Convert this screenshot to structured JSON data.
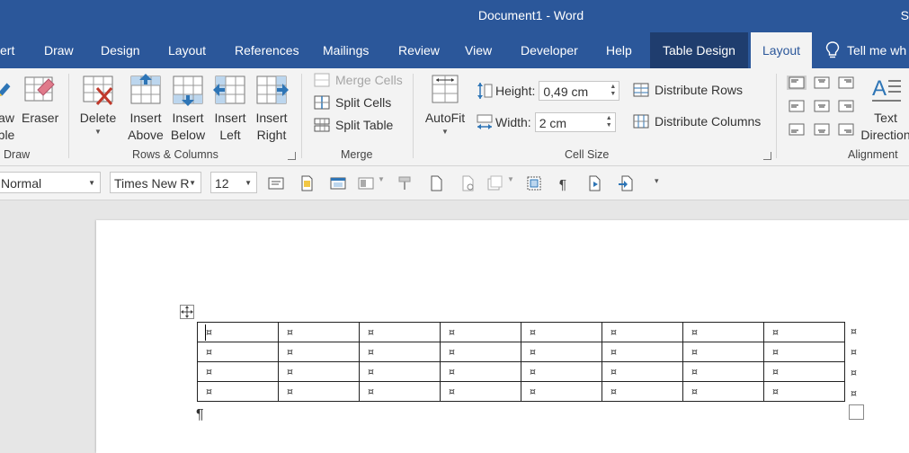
{
  "window": {
    "title": "Document1  -  Word",
    "corner_letter": "S"
  },
  "tabs": [
    {
      "label": "ert"
    },
    {
      "label": "Draw"
    },
    {
      "label": "Design"
    },
    {
      "label": "Layout"
    },
    {
      "label": "References"
    },
    {
      "label": "Mailings"
    },
    {
      "label": "Review"
    },
    {
      "label": "View"
    },
    {
      "label": "Developer"
    },
    {
      "label": "Help"
    },
    {
      "label": "Table Design"
    },
    {
      "label": "Layout",
      "active": true
    }
  ],
  "tell_me": {
    "label": "Tell me wh"
  },
  "ribbon": {
    "draw": {
      "draw_table_label_1": "aw",
      "draw_table_label_2": "ble",
      "eraser_label": "Eraser",
      "group_label": "Draw"
    },
    "rows_columns": {
      "delete_label": "Delete",
      "insert_above_1": "Insert",
      "insert_above_2": "Above",
      "insert_below_1": "Insert",
      "insert_below_2": "Below",
      "insert_left_1": "Insert",
      "insert_left_2": "Left",
      "insert_right_1": "Insert",
      "insert_right_2": "Right",
      "group_label": "Rows & Columns"
    },
    "merge": {
      "merge_cells": "Merge Cells",
      "split_cells": "Split Cells",
      "split_table": "Split Table",
      "group_label": "Merge"
    },
    "cell_size": {
      "autofit_label": "AutoFit",
      "height_label": "Height:",
      "height_value": "0,49 cm",
      "width_label": "Width:",
      "width_value": "2 cm",
      "distribute_rows": "Distribute Rows",
      "distribute_columns": "Distribute Columns",
      "group_label": "Cell Size"
    },
    "alignment": {
      "text_direction_1": "Text",
      "text_direction_2": "Direction",
      "group_label": "Alignment"
    }
  },
  "format_toolbar": {
    "style": "Normal",
    "font": "Times New R",
    "size": "12"
  },
  "document": {
    "cell_marker": "¤",
    "row_end_marker": "¤",
    "paragraph_mark": "¶",
    "rows": 4,
    "columns": 8
  },
  "colors": {
    "accent": "#2b579a",
    "context_tab": "#1f3d6e",
    "ribbon_bg": "#f3f3f3",
    "doc_bg": "#e6e6e6",
    "icon_blue": "#2e75b6",
    "icon_red": "#c0392b"
  }
}
